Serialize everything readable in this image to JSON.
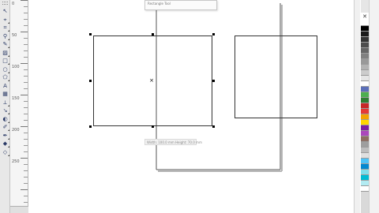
{
  "toolbox": {
    "tools": [
      {
        "name": "pick-tool-icon",
        "glyph": "↖",
        "flyout": false
      },
      {
        "name": "shape-tool-icon",
        "glyph": "⌖",
        "flyout": true
      },
      {
        "name": "crop-tool-icon",
        "glyph": "⌗",
        "flyout": true
      },
      {
        "name": "zoom-tool-icon",
        "glyph": "⚲",
        "flyout": true
      },
      {
        "name": "freehand-tool-icon",
        "glyph": "✎",
        "flyout": true
      },
      {
        "name": "smart-fill-icon",
        "glyph": "▨",
        "flyout": true
      },
      {
        "name": "rectangle-tool-icon",
        "glyph": "□",
        "flyout": true
      },
      {
        "name": "ellipse-tool-icon",
        "glyph": "○",
        "flyout": true
      },
      {
        "name": "polygon-tool-icon",
        "glyph": "⬠",
        "flyout": true
      },
      {
        "name": "text-tool-icon",
        "glyph": "A",
        "flyout": false
      },
      {
        "name": "table-tool-icon",
        "glyph": "▦",
        "flyout": false
      },
      {
        "name": "dimension-tool-icon",
        "glyph": "⟂",
        "flyout": true
      },
      {
        "name": "connector-tool-icon",
        "glyph": "↘",
        "flyout": true
      },
      {
        "name": "blend-tool-icon",
        "glyph": "◐",
        "flyout": true
      },
      {
        "name": "eyedropper-tool-icon",
        "glyph": "✐",
        "flyout": true
      },
      {
        "name": "outline-tool-icon",
        "glyph": "✒",
        "flyout": true
      },
      {
        "name": "fill-tool-icon",
        "glyph": "◆",
        "flyout": true
      },
      {
        "name": "interactive-fill-icon",
        "glyph": "◇",
        "flyout": true
      }
    ]
  },
  "ruler": {
    "labels": [
      "0",
      "50",
      "100",
      "150",
      "200",
      "250"
    ]
  },
  "hint": {
    "title": "Rectangle Tool",
    "field": "Width: 100.0 mm  Height: 70.0 mm"
  },
  "palette": {
    "close_glyph": "✕",
    "swatches": [
      "#ffffff",
      "#000000",
      "#1a1a1a",
      "#333333",
      "#4d4d4d",
      "#666666",
      "#808080",
      "#999999",
      "#b3b3b3",
      "#cccccc",
      "#e6e6e6",
      "#ffffff",
      "#5b6fb8",
      "#4caf50",
      "#2e7d32",
      "#c62828",
      "#e53935",
      "#f4a300",
      "#ffd600",
      "#7b1fa2",
      "#ab47bc",
      "#8d6e63",
      "#9e9e9e",
      "#bdbdbd",
      "#e0e0e0",
      "#4fc3f7",
      "#0288d1",
      "#80deea",
      "#00bcd4",
      "#b2ebf2",
      "#ffffff"
    ]
  }
}
